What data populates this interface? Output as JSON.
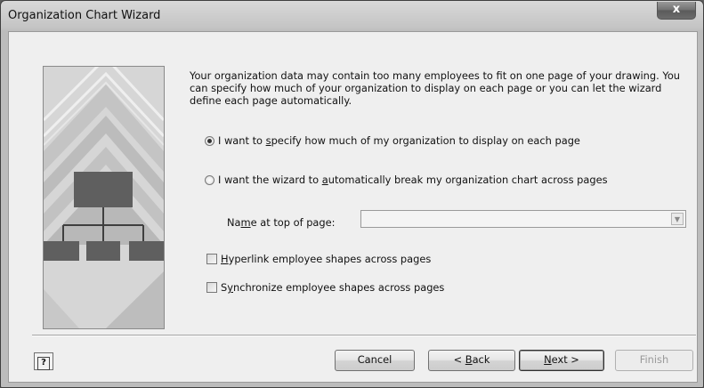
{
  "window": {
    "title": "Organization Chart Wizard",
    "close_label": "x"
  },
  "intro_text": "Your organization data may contain too many employees to fit on one page of your drawing.  You can specify how much of your organization to display on each page or you can let the wizard define each page automatically.",
  "options": {
    "specify": {
      "label_before": "I want to ",
      "label_mnemonic": "s",
      "label_after": "pecify how much of my organization to display on each page",
      "checked": true
    },
    "automatic": {
      "label_before": "I want the wizard to ",
      "label_mnemonic": "a",
      "label_after": "utomatically break my organization chart across pages",
      "checked": false
    }
  },
  "name_field": {
    "label_before": "Na",
    "label_mnemonic": "m",
    "label_after": "e at top of page:",
    "value": ""
  },
  "checkboxes": {
    "hyperlink": {
      "label_mnemonic": "H",
      "label_after": "yperlink employee shapes across pages",
      "checked": false
    },
    "synchronize": {
      "label_before": "S",
      "label_mnemonic": "y",
      "label_after": "nchronize employee shapes across pages",
      "checked": false
    }
  },
  "buttons": {
    "help": "?",
    "cancel": "Cancel",
    "back_before": "< ",
    "back_mnemonic": "B",
    "back_after": "ack",
    "next_mnemonic": "N",
    "next_after": "ext >",
    "finish": "Finish"
  },
  "icons": {
    "help": "help-icon",
    "close": "close-icon",
    "dropdown": "chevron-down-icon",
    "illustration": "org-chart-illustration"
  }
}
